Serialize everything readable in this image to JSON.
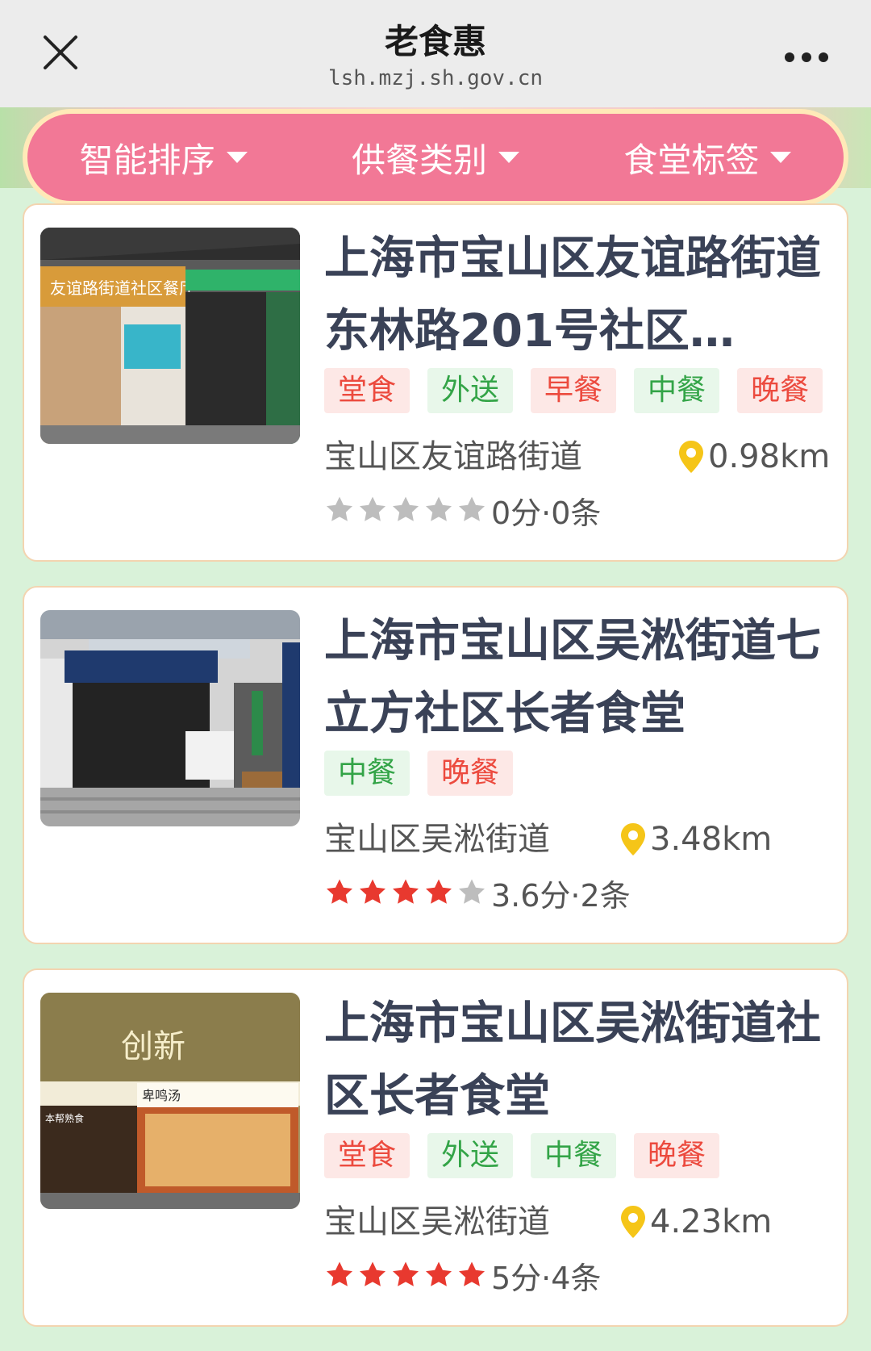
{
  "header": {
    "title": "老食惠",
    "url": "lsh.mzj.sh.gov.cn"
  },
  "filters": [
    {
      "label": "智能排序"
    },
    {
      "label": "供餐类别"
    },
    {
      "label": "食堂标签"
    }
  ],
  "canteens": [
    {
      "name": "上海市宝山区友谊路街道东林路201号社区…",
      "tags": [
        {
          "label": "堂食",
          "color": "red"
        },
        {
          "label": "外送",
          "color": "green"
        },
        {
          "label": "早餐",
          "color": "red"
        },
        {
          "label": "中餐",
          "color": "green"
        },
        {
          "label": "晚餐",
          "color": "red"
        }
      ],
      "district": "宝山区友谊路街道",
      "distance": "0.98km",
      "stars": 0,
      "rating": "0分·0条",
      "photo_signs": [
        "友谊路街道社区餐厅"
      ]
    },
    {
      "name": "上海市宝山区吴淞街道七立方社区长者食堂",
      "tags": [
        {
          "label": "中餐",
          "color": "green"
        },
        {
          "label": "晚餐",
          "color": "red"
        }
      ],
      "district": "宝山区吴淞街道",
      "distance": "3.48km",
      "stars": 4,
      "rating": "3.6分·2条",
      "photo_signs": []
    },
    {
      "name": "上海市宝山区吴淞街道社区长者食堂",
      "tags": [
        {
          "label": "堂食",
          "color": "red"
        },
        {
          "label": "外送",
          "color": "green"
        },
        {
          "label": "中餐",
          "color": "green"
        },
        {
          "label": "晚餐",
          "color": "red"
        }
      ],
      "district": "宝山区吴淞街道",
      "distance": "4.23km",
      "stars": 5,
      "rating": "5分·4条",
      "photo_signs": [
        "创新",
        "卑鸣汤",
        "本帮熟食"
      ]
    }
  ],
  "colors": {
    "accent": "#f27896",
    "star_on": "#e8392f",
    "star_off": "#bdbdbd",
    "pin": "#f5c518",
    "tag_red": "#ec4a3e",
    "tag_green": "#33a447"
  }
}
